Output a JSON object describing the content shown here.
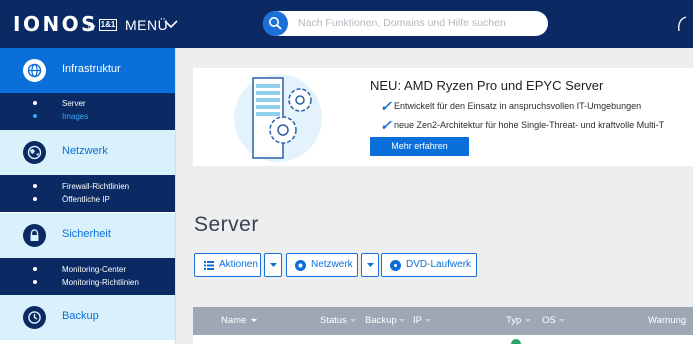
{
  "topbar": {
    "logo": "IONOS",
    "logo_by": "by",
    "logo_partner": "1&1",
    "menu_label": "MENÜ",
    "search_placeholder": "Nach Funktionen, Domains und Hilfe suchen"
  },
  "sidebar": {
    "sections": [
      {
        "label": "Infrastruktur",
        "icon": "globe-icon",
        "active": true,
        "items": [
          {
            "label": "Server",
            "active": true
          },
          {
            "label": "Images",
            "active": false
          }
        ]
      },
      {
        "label": "Netzwerk",
        "icon": "network-globe-icon",
        "active": false,
        "items": [
          {
            "label": "Firewall-Richtlinien"
          },
          {
            "label": "Öffentliche IP"
          }
        ]
      },
      {
        "label": "Sicherheit",
        "icon": "lock-icon",
        "active": false,
        "items": [
          {
            "label": "Monitoring-Center"
          },
          {
            "label": "Monitoring-Richtlinien"
          }
        ]
      },
      {
        "label": "Backup",
        "icon": "clock-icon",
        "active": false,
        "items": []
      }
    ]
  },
  "banner": {
    "title": "NEU: AMD Ryzen Pro und EPYC Server",
    "features": [
      "Entwickelt für den Einsatz in anspruchsvollen IT-Umgebungen",
      "neue Zen2-Architektur für hohe Single-Threat- und kraftvolle Multi-T"
    ],
    "cta": "Mehr erfahren"
  },
  "page": {
    "title": "Server"
  },
  "toolbar": {
    "actions_label": "Aktionen",
    "network_label": "Netzwerk",
    "dvd_label": "DVD-Laufwerk"
  },
  "table": {
    "columns": [
      "Name",
      "Status",
      "Backup",
      "IP",
      "Typ",
      "OS",
      "Warnung"
    ]
  },
  "colors": {
    "topbar": "#0b2a63",
    "accent": "#0b6fd9",
    "sidebar_light": "#d9f1fa",
    "table_header": "#a0a7b4"
  }
}
